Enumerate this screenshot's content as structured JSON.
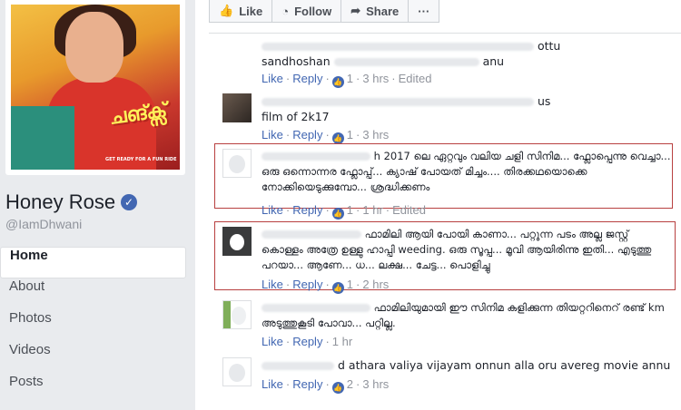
{
  "page": {
    "name": "Honey Rose",
    "handle": "@IamDhwani"
  },
  "profile_picture": {
    "poster_title": "ചങ്ക്സ്",
    "poster_tagline": "GET READY FOR A FUN RIDE"
  },
  "nav": [
    {
      "label": "Home",
      "active": true
    },
    {
      "label": "About"
    },
    {
      "label": "Photos"
    },
    {
      "label": "Videos"
    },
    {
      "label": "Posts"
    }
  ],
  "actions": {
    "like": "Like",
    "follow": "Follow",
    "share": "Share",
    "more": "···"
  },
  "labels": {
    "like": "Like",
    "reply": "Reply",
    "edited": "Edited"
  },
  "comments": [
    {
      "partial_line": "ottu",
      "text": "sandhoshan",
      "tail": "anu",
      "likes": "1",
      "time": "3 hrs",
      "edited": true
    },
    {
      "partial_line": "us",
      "text": "film of 2k17",
      "likes": "1",
      "time": "3 hrs"
    },
    {
      "name_end": "h",
      "text": "2017 ലെ ഏറ്റവും വലിയ ചളി സിനിമ... ഫ്ലോപ്പെന്നു വെച്ചാ... ഒരു ഒന്നൊന്നര ഫ്ലോപ്പ്... ക്യാഷ് പോയത് മിച്ചം.... തിരക്കഥയൊക്കെ നോക്കിയെടുക്കുമ്പോ... ശ്രദ്ധിക്കണം",
      "likes": "1",
      "time": "1 hr",
      "edited": true
    },
    {
      "text": "ഫാമിലി ആയി പോയി കാണാ... പറ്റുന്ന പടം അല്ല ജസ്റ്റ് കൊള്ളം അത്രേ ഉള്ളു ഹാപ്പി weeding. ഒരു സൂപ്പ... മൂവി ആയിരിന്നു ഇതി... എടുത്തു പറയാ... ആണേ... ധ... ലക്ഷ... ചേട്ട... പൊളിച്ചു",
      "likes": "1",
      "time": "2 hrs"
    },
    {
      "text": "ഫാമിലിയുമായി ഈ സിനിമ കളിക്കുന്ന തിയറ്ററിനെറ് രണ്ട് km അടുത്തുകൂടി പോവാ... പറ്റില്ല.",
      "time": "1 hr"
    },
    {
      "name_end": "d",
      "text": "athara valiya vijayam onnun alla oru avereg movie annu",
      "likes": "2",
      "time": "3 hrs"
    }
  ]
}
